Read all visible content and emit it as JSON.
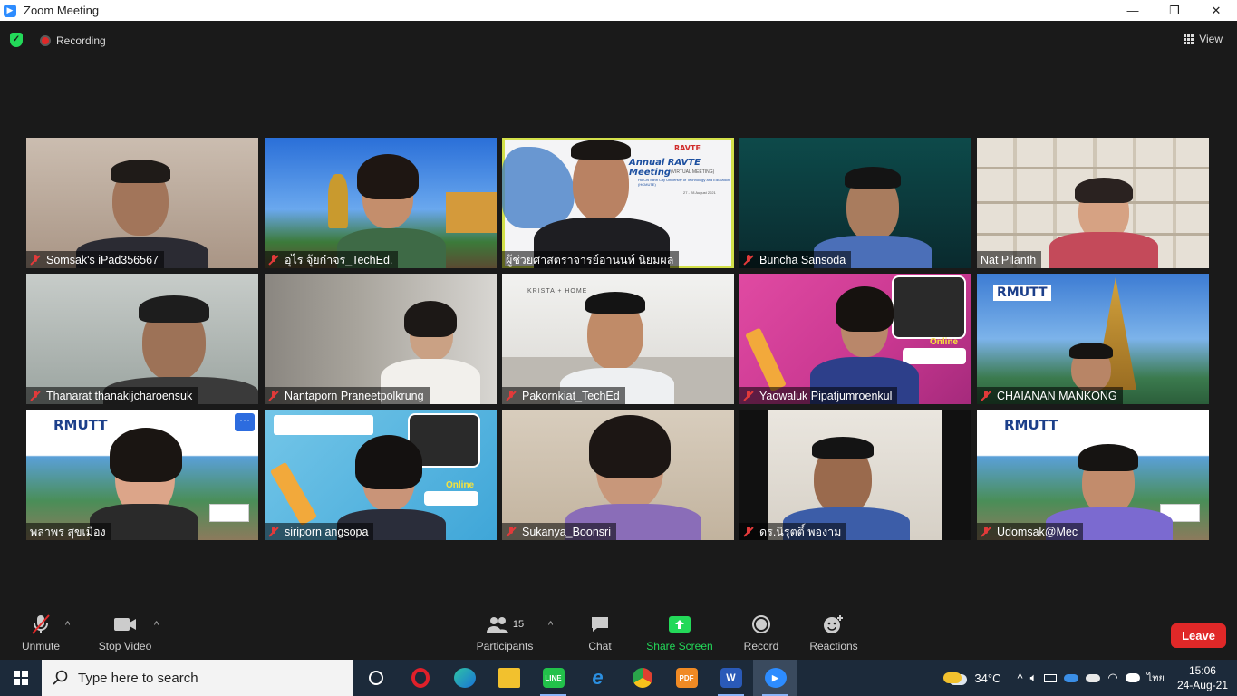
{
  "window": {
    "title": "Zoom Meeting"
  },
  "meeting_bar": {
    "recording_label": "Recording",
    "view_label": "View"
  },
  "participants": [
    {
      "name": "Somsak's iPad356567",
      "muted": true
    },
    {
      "name": "อุไร จุ้ยกำจร_TechEd.",
      "muted": true
    },
    {
      "name": "ผู้ช่วยศาสตราจารย์อานนท์ นิยมผล",
      "muted": false,
      "active_speaker": true,
      "slide_title": "Annual RAVTE Meeting",
      "slide_sub": "(VIRTUAL MEETING)",
      "slide_org": "Ho Chi Minh City University of Technology and Education (HCMUTE)",
      "slide_date": "27 - 28 August 2021",
      "slide_logo": "RAVTE"
    },
    {
      "name": "Buncha Sansoda",
      "muted": true
    },
    {
      "name": "Nat Pilanth",
      "muted": false
    },
    {
      "name": "Thanarat thanakijcharoensuk",
      "muted": true
    },
    {
      "name": "Nantaporn Praneetpolkrung",
      "muted": true
    },
    {
      "name": "Pakornkiat_TechEd",
      "muted": true,
      "wall_text": "KRISTA + HOME"
    },
    {
      "name": "Yaowaluk Pipatjumroenkul",
      "muted": true,
      "badge": "Online"
    },
    {
      "name": "CHAIANAN MANKONG",
      "muted": true,
      "logo": "RMUTT"
    },
    {
      "name": "พลาพร สุขเมือง",
      "muted": false,
      "logo": "RMUTT",
      "more": "···"
    },
    {
      "name": "siriporn angsopa",
      "muted": true,
      "badge": "Online"
    },
    {
      "name": "Sukanya_Boonsri",
      "muted": true
    },
    {
      "name": "ดร.นิรุตติ์ พองาม",
      "muted": true
    },
    {
      "name": "Udomsak@Mec",
      "muted": true,
      "logo": "RMUTT"
    }
  ],
  "toolbar": {
    "unmute": "Unmute",
    "stop_video": "Stop Video",
    "participants": "Participants",
    "participant_count": "15",
    "chat": "Chat",
    "share_screen": "Share Screen",
    "record": "Record",
    "reactions": "Reactions",
    "leave": "Leave"
  },
  "taskbar": {
    "search_placeholder": "Type here to search",
    "weather": "34°C",
    "language": "ไทย",
    "time": "15:06",
    "date": "24-Aug-21"
  },
  "colors": {
    "accent": "#2d8cff",
    "danger": "#e02828",
    "share": "#23d959",
    "active": "#d3e04a"
  }
}
